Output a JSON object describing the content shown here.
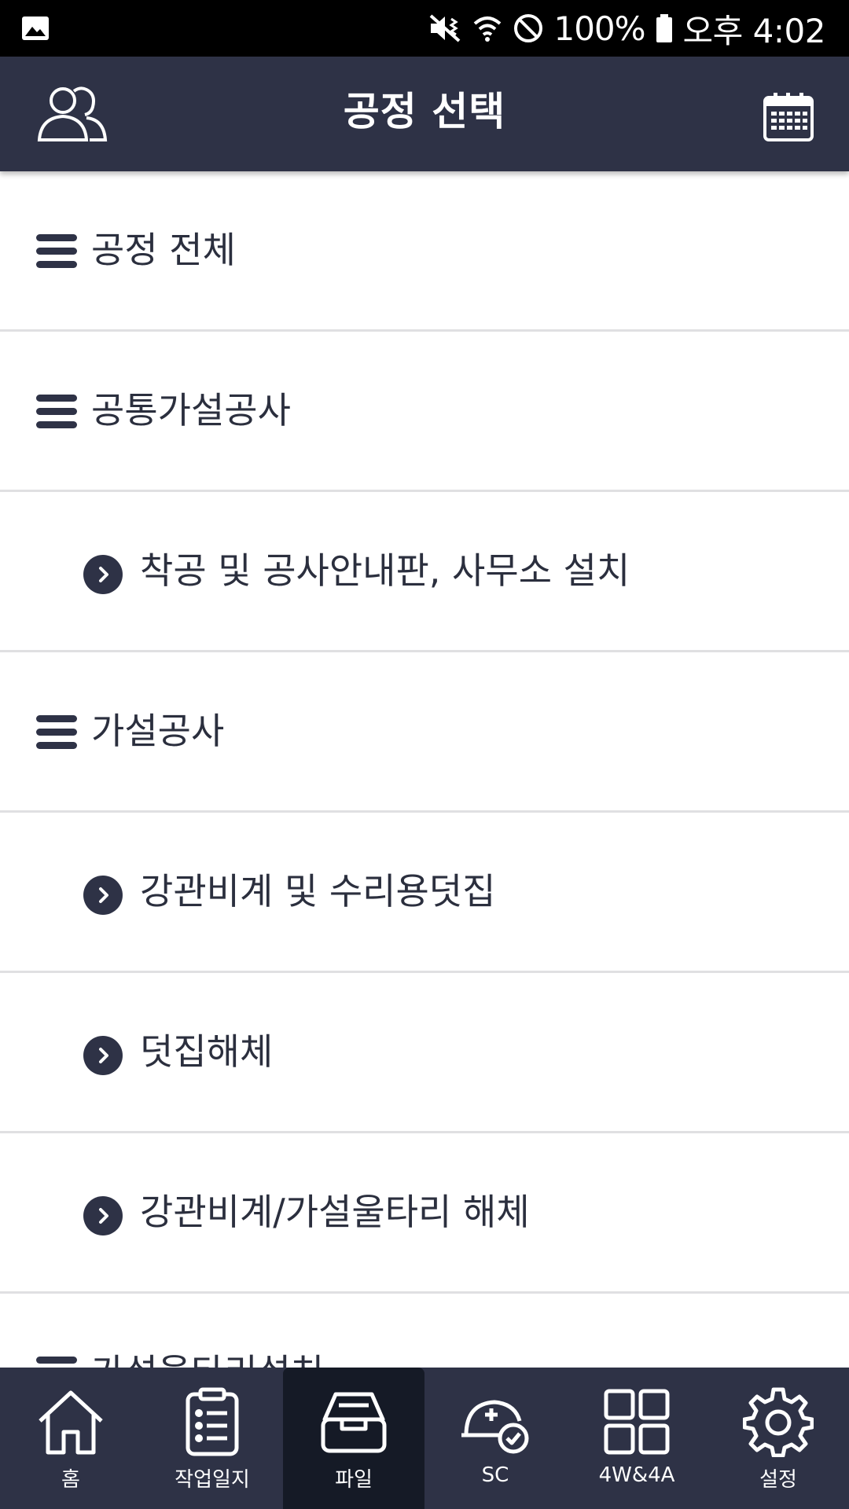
{
  "status_bar": {
    "battery": "100%",
    "time": "오후 4:02"
  },
  "header": {
    "title": "공정 선택"
  },
  "list": {
    "items": [
      {
        "type": "category",
        "label": "공정 전체"
      },
      {
        "type": "category",
        "label": "공통가설공사"
      },
      {
        "type": "item",
        "label": "착공 및 공사안내판, 사무소 설치"
      },
      {
        "type": "category",
        "label": "가설공사"
      },
      {
        "type": "item",
        "label": "강관비계 및 수리용덧집"
      },
      {
        "type": "item",
        "label": "덧집해체"
      },
      {
        "type": "item",
        "label": "강관비계/가설울타리 해체"
      },
      {
        "type": "category",
        "label": "가설울타리설치"
      }
    ]
  },
  "bottom_nav": {
    "items": [
      {
        "label": "홈",
        "icon": "home-icon"
      },
      {
        "label": "작업일지",
        "icon": "clipboard-icon"
      },
      {
        "label": "파일",
        "icon": "inbox-icon",
        "active": true
      },
      {
        "label": "SC",
        "icon": "helmet-icon"
      },
      {
        "label": "4W&4A",
        "icon": "grid-icon"
      },
      {
        "label": "설정",
        "icon": "gear-icon"
      }
    ]
  }
}
